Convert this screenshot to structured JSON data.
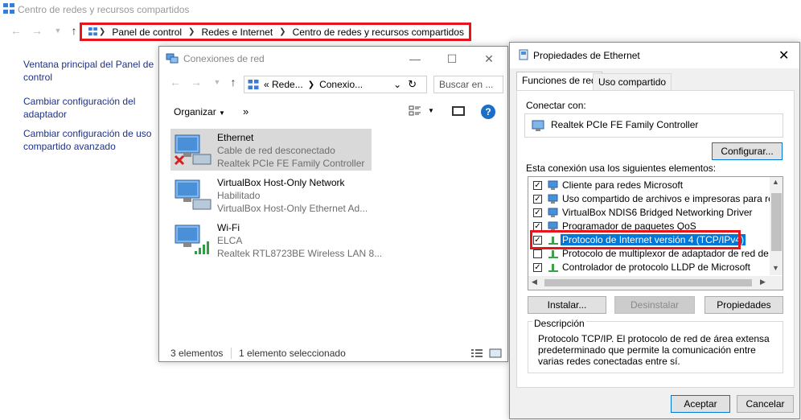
{
  "background_window": {
    "title": "Centro de redes y recursos compartidos",
    "breadcrumb": [
      "Panel de control",
      "Redes e Internet",
      "Centro de redes y recursos compartidos"
    ],
    "sidebar_links": [
      "Ventana principal del Panel de control",
      "Cambiar configuración del adaptador",
      "Cambiar configuración de uso compartido avanzado"
    ]
  },
  "connections_window": {
    "title": "Conexiones de red",
    "address": [
      "«  Rede...",
      "Conexio..."
    ],
    "search_placeholder": "Buscar en ...",
    "toolbar": {
      "organize": "Organizar",
      "more": "»"
    },
    "items": [
      {
        "name": "Ethernet",
        "status": "Cable de red desconectado",
        "device": "Realtek PCIe FE Family Controller",
        "selected": true
      },
      {
        "name": "VirtualBox Host-Only Network",
        "status": "Habilitado",
        "device": "VirtualBox Host-Only Ethernet Ad...",
        "selected": false
      },
      {
        "name": "Wi-Fi",
        "status": "ELCA",
        "device": "Realtek RTL8723BE Wireless LAN 8...",
        "selected": false
      }
    ],
    "status_bar": {
      "count": "3 elementos",
      "selected": "1 elemento seleccionado"
    }
  },
  "properties_window": {
    "title": "Propiedades de Ethernet",
    "tabs": [
      "Funciones de red",
      "Uso compartido"
    ],
    "connect_with_label": "Conectar con:",
    "adapter_name": "Realtek PCIe FE Family Controller",
    "configure_button": "Configurar...",
    "elements_label": "Esta conexión usa los siguientes elementos:",
    "elements": [
      {
        "label": "Cliente para redes Microsoft",
        "checked": true
      },
      {
        "label": "Uso compartido de archivos e impresoras para redes M",
        "checked": true
      },
      {
        "label": "VirtualBox NDIS6 Bridged Networking Driver",
        "checked": true
      },
      {
        "label": "Programador de paquetes QoS",
        "checked": true
      },
      {
        "label": "Protocolo de Internet versión 4 (TCP/IPv4)",
        "checked": true,
        "selected": true
      },
      {
        "label": "Protocolo de multiplexor de adaptador de red de Micros",
        "checked": false
      },
      {
        "label": "Controlador de protocolo LLDP de Microsoft",
        "checked": true
      }
    ],
    "buttons": {
      "install": "Instalar...",
      "uninstall": "Desinstalar",
      "properties": "Propiedades"
    },
    "description_title": "Descripción",
    "description_text": "Protocolo TCP/IP. El protocolo de red de área extensa predeterminado que permite la comunicación entre varias redes conectadas entre sí.",
    "accept": "Aceptar",
    "cancel": "Cancelar"
  },
  "colors": {
    "highlight": "#e8141c",
    "selection": "#0078d7",
    "link": "#1e3287"
  }
}
